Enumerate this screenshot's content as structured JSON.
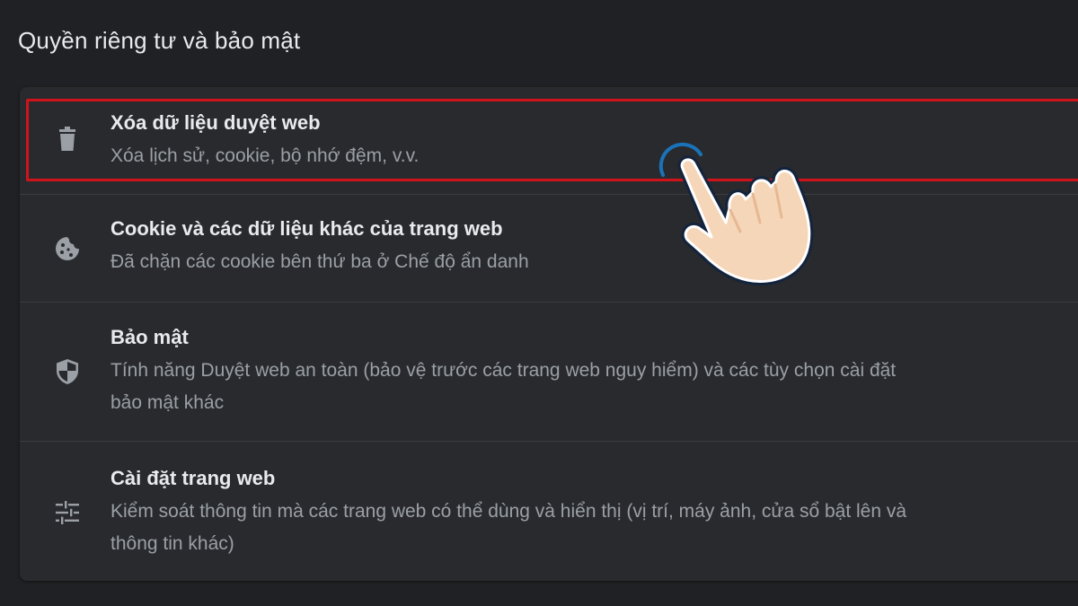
{
  "section": {
    "title": "Quyền riêng tư và bảo mật"
  },
  "items": [
    {
      "icon": "trash-icon",
      "title": "Xóa dữ liệu duyệt web",
      "desc_lines": [
        "Xóa lịch sử, cookie, bộ nhớ đệm, v.v."
      ]
    },
    {
      "icon": "cookie-icon",
      "title": "Cookie và các dữ liệu khác của trang web",
      "desc_lines": [
        "Đã chặn các cookie bên thứ ba ở Chế độ ẩn danh"
      ]
    },
    {
      "icon": "shield-icon",
      "title": "Bảo mật",
      "desc_lines": [
        "Tính năng Duyệt web an toàn (bảo vệ trước các trang web nguy hiểm) và các tùy chọn cài đặt",
        "bảo mật khác"
      ]
    },
    {
      "icon": "tune-icon",
      "title": "Cài đặt trang web",
      "desc_lines": [
        "Kiểm soát thông tin mà các trang web có thể dùng và hiển thị (vị trí, máy ảnh, cửa sổ bật lên và",
        "thông tin khác)"
      ]
    }
  ],
  "colors": {
    "background": "#202124",
    "card": "#292a2d",
    "highlight": "#d0131b",
    "text_primary": "#e8eaed",
    "text_secondary": "#9aa0a6"
  }
}
